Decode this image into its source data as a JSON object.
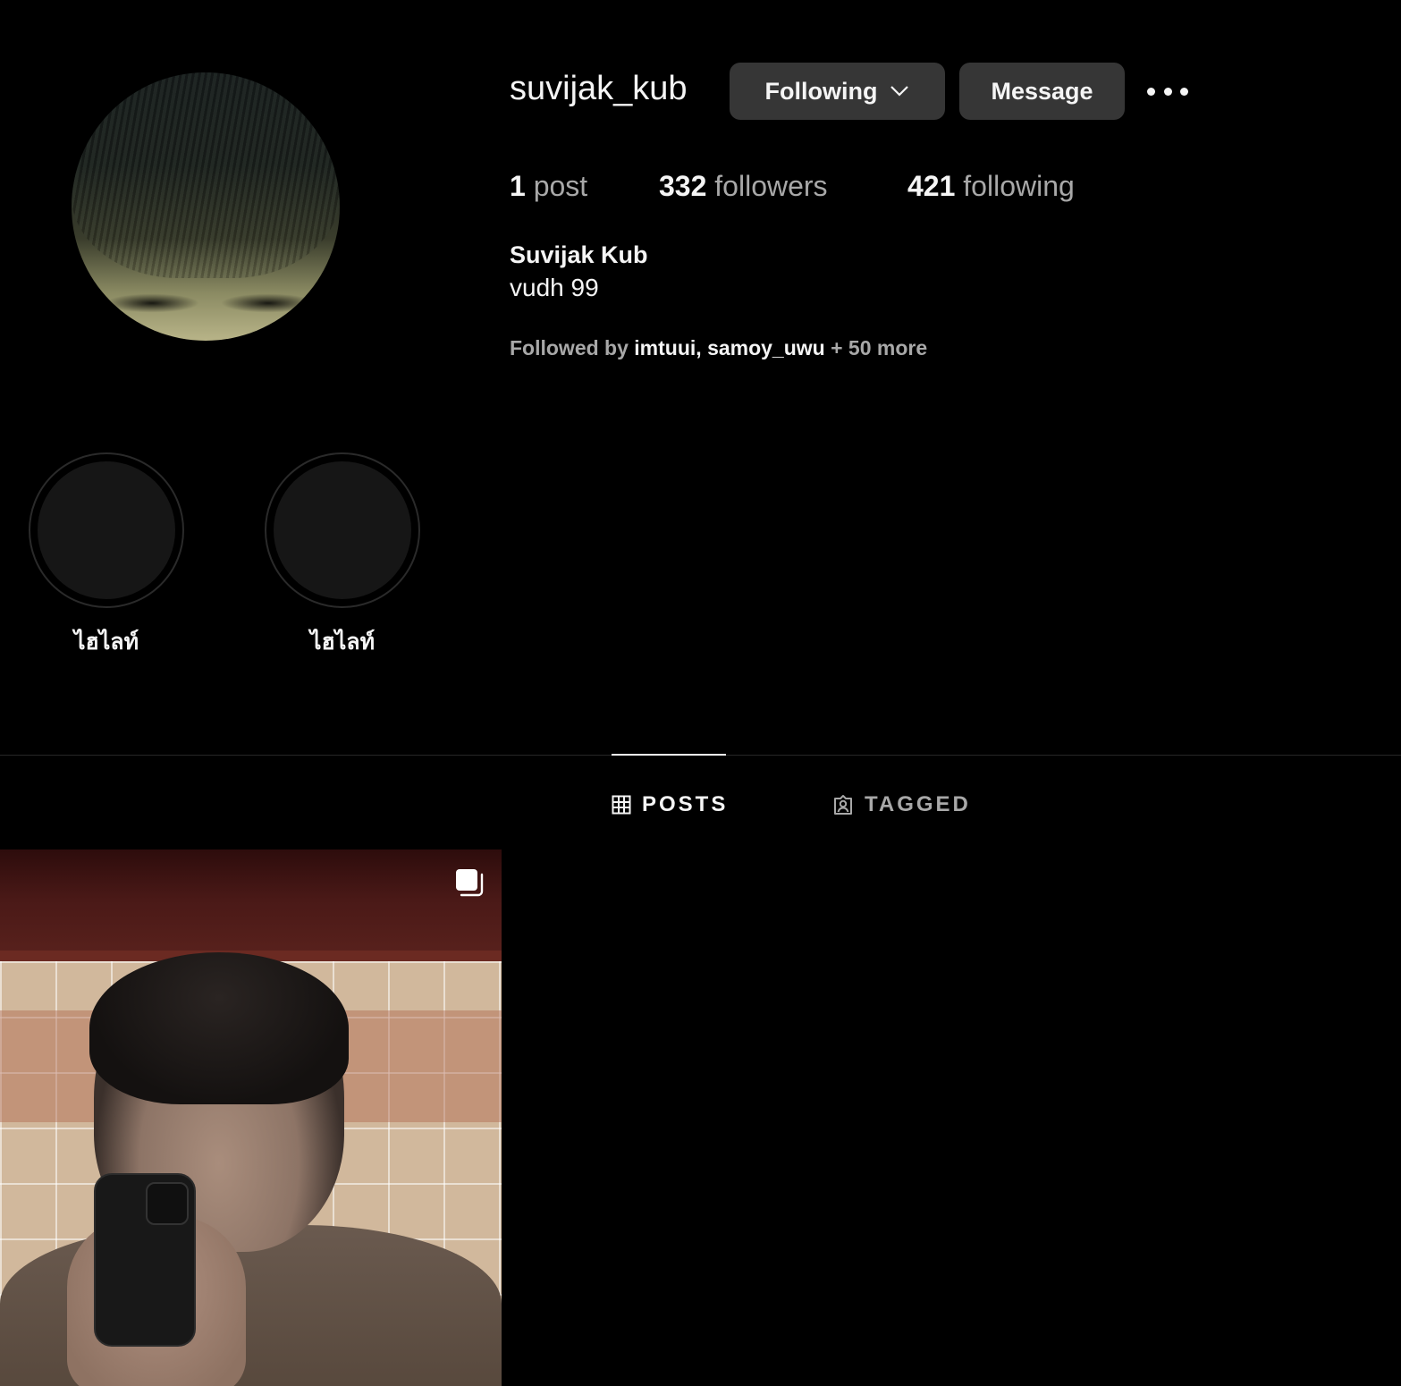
{
  "profile": {
    "username": "suvijak_kub",
    "following_button": "Following",
    "message_button": "Message",
    "stats": {
      "posts_count": "1",
      "posts_label": " post",
      "followers_count": "332",
      "followers_label": " followers",
      "following_count": "421",
      "following_label": " following"
    },
    "full_name": "Suvijak Kub",
    "bio": "vudh 99",
    "followed_by": {
      "prefix": "Followed by ",
      "user1": "imtuui",
      "sep": ", ",
      "user2": "samoy_uwu",
      "suffix": " + 50 more"
    }
  },
  "highlights": [
    {
      "label": "ไฮไลท์"
    },
    {
      "label": "ไฮไลท์"
    }
  ],
  "tabs": {
    "posts": "POSTS",
    "tagged": "TAGGED"
  },
  "colors": {
    "background": "#000000",
    "button": "#363636",
    "text_primary": "#f5f5f5",
    "text_secondary": "#a8a8a8",
    "divider": "#262626"
  },
  "icons": {
    "chevron": "chevron-down-icon",
    "more": "more-options-icon",
    "grid": "grid-icon",
    "tagged": "tagged-user-icon",
    "multi": "carousel-icon"
  }
}
